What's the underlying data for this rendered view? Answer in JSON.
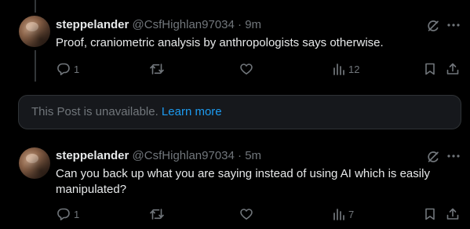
{
  "posts": [
    {
      "author": "steppelander",
      "handle": "@CsfHighlan97034",
      "separator": "·",
      "time": "9m",
      "text": "Proof, craniometric analysis by anthropologists says otherwise.",
      "replies": "1",
      "reposts": "",
      "likes": "",
      "views": "12"
    },
    {
      "author": "steppelander",
      "handle": "@CsfHighlan97034",
      "separator": "·",
      "time": "5m",
      "text": "Can you back up what you are saying instead of using AI which is easily manipulated?",
      "replies": "1",
      "reposts": "",
      "likes": "",
      "views": "7"
    }
  ],
  "unavailable": {
    "message": "This Post is unavailable.",
    "link": "Learn more"
  },
  "colors": {
    "background": "#000000",
    "text": "#e7e9ea",
    "muted": "#71767b",
    "link": "#1d9bf0",
    "card": "#16181c"
  },
  "icons": {
    "top": [
      "grok-icon",
      "more-icon"
    ],
    "actions": [
      "reply-icon",
      "repost-icon",
      "like-icon",
      "views-icon",
      "bookmark-icon",
      "share-icon"
    ]
  }
}
